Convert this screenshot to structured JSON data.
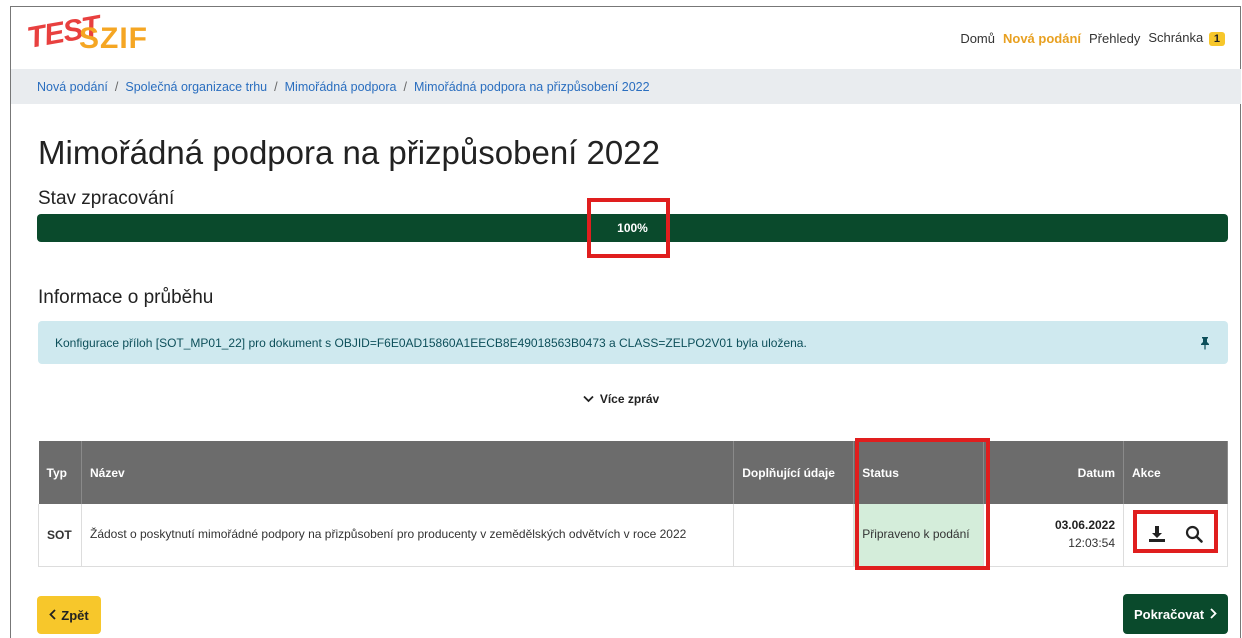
{
  "header": {
    "logo_test": "TEST",
    "logo_brand": "SZIF",
    "nav": [
      {
        "label": "Domů",
        "active": false
      },
      {
        "label": "Nová podání",
        "active": true
      },
      {
        "label": "Přehledy",
        "active": false
      },
      {
        "label": "Schránka",
        "active": false
      }
    ],
    "inbox_count": "1"
  },
  "breadcrumb": [
    "Nová podání",
    "Společná organizace trhu",
    "Mimořádná podpora",
    "Mimořádná podpora na přizpůsobení 2022"
  ],
  "page": {
    "title": "Mimořádná podpora na přizpůsobení 2022",
    "processing_label": "Stav zpracování",
    "progress_value": 100,
    "progress_text": "100%",
    "info_label": "Informace o průběhu",
    "alert_text": "Konfigurace příloh [SOT_MP01_22] pro dokument s OBJID=F6E0AD15860A1EECB8E49018563B0473 a CLASS=ZELPO2V01 byla uložena.",
    "more_messages": "Více zpráv"
  },
  "table": {
    "headers": {
      "typ": "Typ",
      "nazev": "Název",
      "doplnujici": "Doplňující údaje",
      "status": "Status",
      "datum": "Datum",
      "akce": "Akce"
    },
    "rows": [
      {
        "typ": "SOT",
        "nazev": "Žádost o poskytnutí mimořádné podpory na přizpůsobení pro producenty v zemědělských odvětvích v roce 2022",
        "doplnujici": "",
        "status": "Připraveno k podání",
        "date": "03.06.2022",
        "time": "12:03:54"
      }
    ]
  },
  "buttons": {
    "back": "Zpět",
    "next": "Pokračovat"
  },
  "colors": {
    "accent_green": "#0a4a2c",
    "accent_yellow": "#f7c72b",
    "highlight_red": "#e01e1e"
  },
  "icons": {
    "download": "download-icon",
    "search": "search-icon",
    "pin": "pin-icon"
  }
}
